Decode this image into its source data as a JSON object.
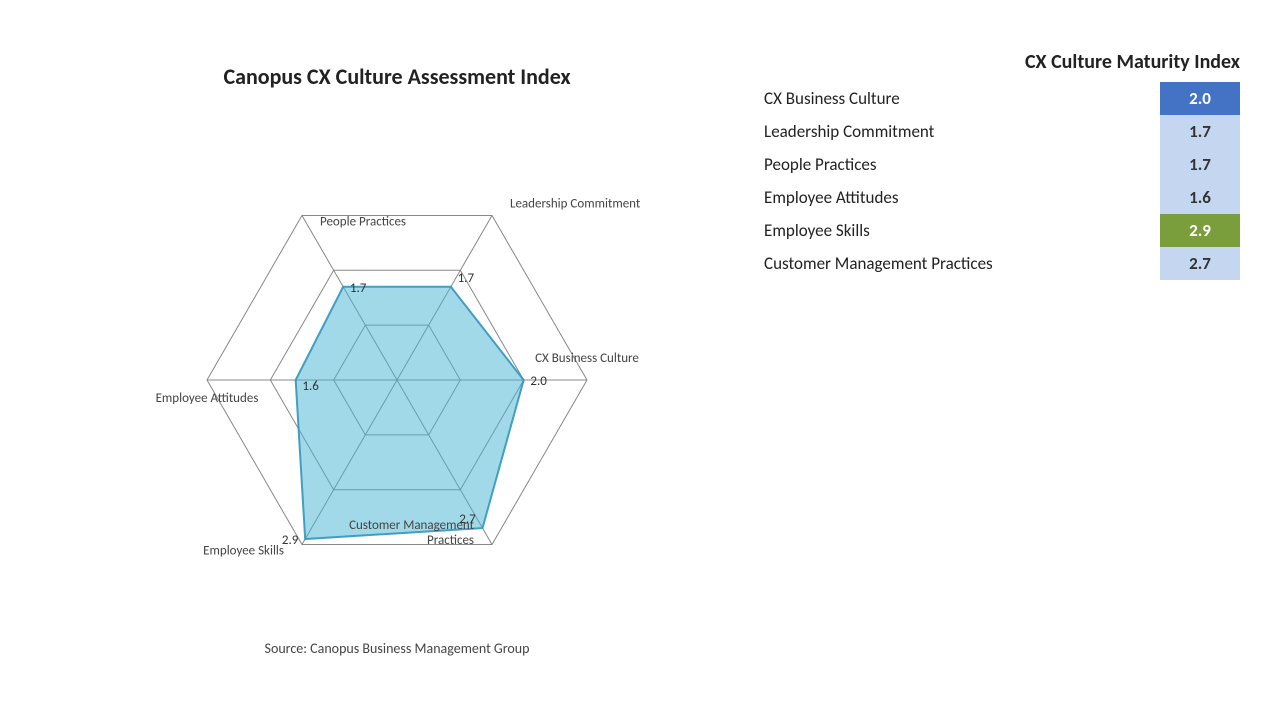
{
  "chart": {
    "title": "Canopus CX Culture Assessment Index",
    "source": "Source: Canopus Business Management Group",
    "axes": [
      {
        "label": "CX Business Culture",
        "value": 2.0,
        "angle_deg": 90
      },
      {
        "label": "Leadership Commitment",
        "value": 1.7,
        "angle_deg": 30
      },
      {
        "label": "People Practices",
        "value": 1.7,
        "angle_deg": -30
      },
      {
        "label": "Employee Attitudes",
        "value": 1.6,
        "angle_deg": -90
      },
      {
        "label": "Employee Skills",
        "value": 2.9,
        "angle_deg": -150
      },
      {
        "label": "Customer Management Practices",
        "value": 2.7,
        "angle_deg": 150
      }
    ],
    "max_value": 3.0
  },
  "table": {
    "title": "CX Culture Maturity Index",
    "rows": [
      {
        "label": "CX Business Culture",
        "value": "2.0",
        "highlight": "blue"
      },
      {
        "label": "Leadership Commitment",
        "value": "1.7",
        "highlight": "light"
      },
      {
        "label": "People Practices",
        "value": "1.7",
        "highlight": "light"
      },
      {
        "label": "Employee Attitudes",
        "value": "1.6",
        "highlight": "light"
      },
      {
        "label": "Employee Skills",
        "value": "2.9",
        "highlight": "green"
      },
      {
        "label": "Customer Management Practices",
        "value": "2.7",
        "highlight": "light"
      }
    ]
  }
}
